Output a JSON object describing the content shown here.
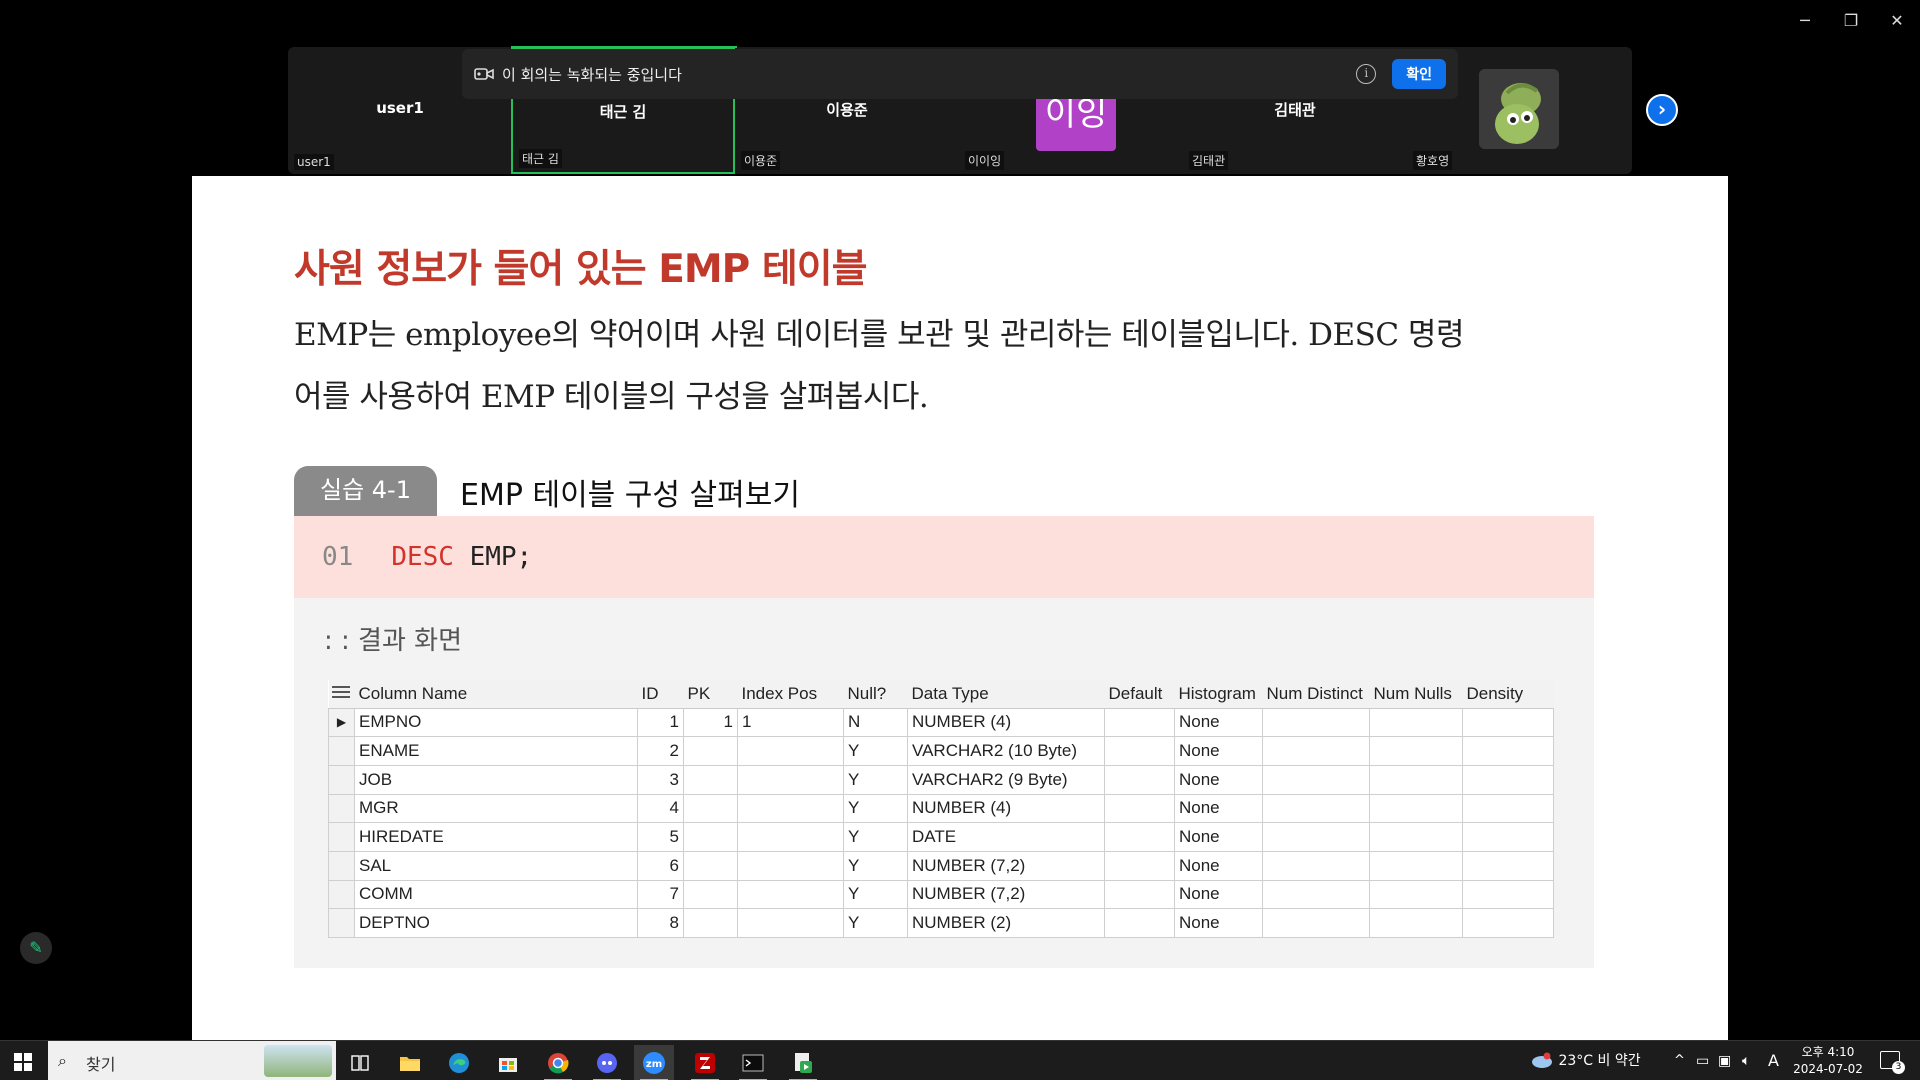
{
  "window": {
    "min": "─",
    "max": "❐",
    "close": "✕"
  },
  "participants": [
    {
      "name": "user1",
      "label": "user1"
    },
    {
      "name": "태근 김",
      "label": "태근 김"
    },
    {
      "name": "이용준",
      "label": "이용준"
    },
    {
      "name": "",
      "avatar_text": "이잉",
      "label": "이이잉"
    },
    {
      "name": "김태관",
      "label": "김태관"
    },
    {
      "name": "",
      "label": "황호영"
    }
  ],
  "recording_banner": {
    "text": "이 회의는 녹화되는 중입니다",
    "info": "i",
    "confirm": "확인"
  },
  "next_button": "›",
  "slide": {
    "title": "사원 정보가 들어 있는 EMP 테이블",
    "body_line1": "EMP는 employee의 약어이며 사원 데이터를 보관 및 관리하는 테이블입니다. DESC 명령",
    "body_line2": "어를 사용하여 EMP 테이블의 구성을 살펴봅시다.",
    "tag": "실습 4-1",
    "tag_title": "EMP 테이블 구성 살펴보기",
    "code": {
      "line_no": "01",
      "keyword": "DESC",
      "rest": "EMP;"
    },
    "result_label": ": : 결과 화면",
    "table": {
      "columns": [
        "Column Name",
        "ID",
        "PK",
        "Index Pos",
        "Null?",
        "Data Type",
        "Default",
        "Histogram",
        "Num Distinct",
        "Num Nulls",
        "Density"
      ],
      "rows": [
        [
          "EMPNO",
          "1",
          "1",
          "1",
          "N",
          "NUMBER (4)",
          "",
          "None",
          "",
          "",
          ""
        ],
        [
          "ENAME",
          "2",
          "",
          "",
          "Y",
          "VARCHAR2 (10 Byte)",
          "",
          "None",
          "",
          "",
          ""
        ],
        [
          "JOB",
          "3",
          "",
          "",
          "Y",
          "VARCHAR2 (9 Byte)",
          "",
          "None",
          "",
          "",
          ""
        ],
        [
          "MGR",
          "4",
          "",
          "",
          "Y",
          "NUMBER (4)",
          "",
          "None",
          "",
          "",
          ""
        ],
        [
          "HIREDATE",
          "5",
          "",
          "",
          "Y",
          "DATE",
          "",
          "None",
          "",
          "",
          ""
        ],
        [
          "SAL",
          "6",
          "",
          "",
          "Y",
          "NUMBER (7,2)",
          "",
          "None",
          "",
          "",
          ""
        ],
        [
          "COMM",
          "7",
          "",
          "",
          "Y",
          "NUMBER (7,2)",
          "",
          "None",
          "",
          "",
          ""
        ],
        [
          "DEPTNO",
          "8",
          "",
          "",
          "Y",
          "NUMBER (2)",
          "",
          "None",
          "",
          "",
          ""
        ]
      ]
    }
  },
  "taskbar": {
    "search_text": "찾기",
    "weather": "23°C  비 약간",
    "ime": "A",
    "time": "오후 4:10",
    "date": "2024-07-02",
    "notifications": "3"
  },
  "colors": {
    "accent": "#0e71eb",
    "active_border": "#25c05b",
    "title_red": "#c0392b",
    "avatar_purple": "#b142c8"
  }
}
